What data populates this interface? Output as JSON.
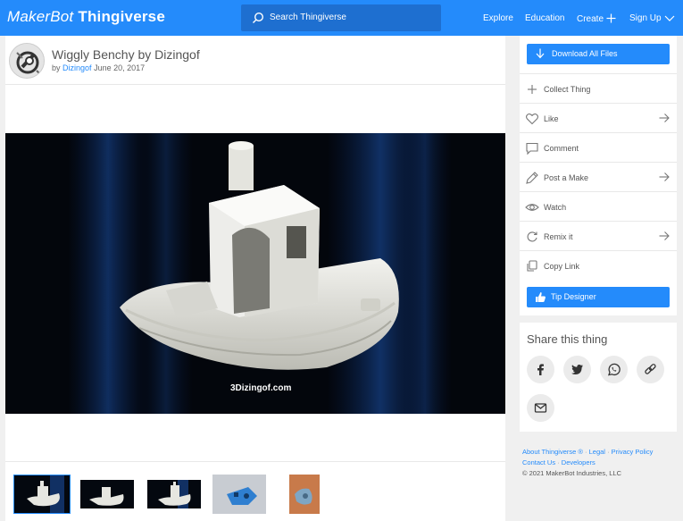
{
  "header": {
    "logo_brand": "MakerBot",
    "logo_product": "Thingiverse",
    "search_placeholder": "Search Thingiverse",
    "nav": [
      "Explore",
      "Education",
      "Create",
      "Sign Up"
    ]
  },
  "thing": {
    "title": "Wiggly Benchy by Dizingof",
    "by": "by",
    "author": "Dizingof",
    "date": "June 20, 2017",
    "watermark": "3Dizingof.com",
    "thumbnail_count": 5
  },
  "sidebar": {
    "download_label": "Download All Files",
    "actions": [
      {
        "label": "Collect Thing",
        "icon": "plus-icon",
        "arrow": false
      },
      {
        "label": "Like",
        "icon": "heart-icon",
        "arrow": true
      },
      {
        "label": "Comment",
        "icon": "comment-icon",
        "arrow": false
      },
      {
        "label": "Post a Make",
        "icon": "pencil-icon",
        "arrow": true
      },
      {
        "label": "Watch",
        "icon": "eye-icon",
        "arrow": false
      },
      {
        "label": "Remix it",
        "icon": "remix-icon",
        "arrow": true
      },
      {
        "label": "Copy Link",
        "icon": "link-icon",
        "arrow": false
      }
    ],
    "tip_label": "Tip Designer"
  },
  "share": {
    "title": "Share this thing",
    "buttons": [
      "facebook-icon",
      "twitter-icon",
      "whatsapp-icon",
      "link-icon",
      "email-icon"
    ]
  },
  "footer": {
    "about": "About Thingiverse ®",
    "legal": "Legal",
    "privacy": "Privacy Policy",
    "contact": "Contact Us",
    "developers": "Developers",
    "copyright": "© 2021 MakerBot Industries, LLC"
  },
  "colors": {
    "brand_blue": "#248bfb",
    "search_bg": "#1e6fd0",
    "page_bg": "#f0f0f0"
  }
}
